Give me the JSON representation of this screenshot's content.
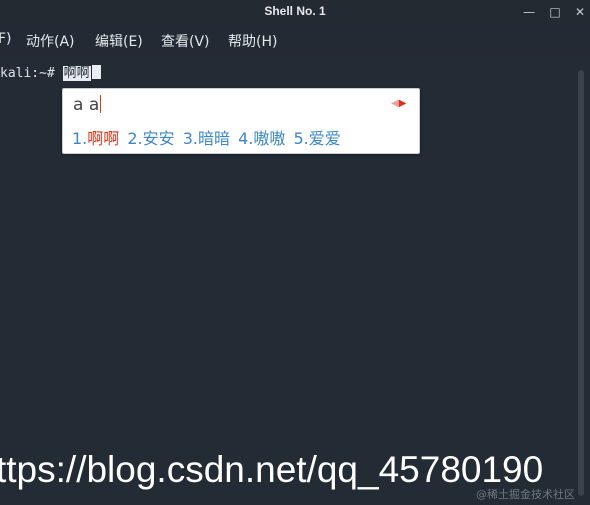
{
  "window": {
    "title": "Shell No. 1",
    "minimize_glyph": "—",
    "maximize_glyph": "□",
    "close_glyph": "✕"
  },
  "menu": {
    "items": [
      "F)",
      "动作(A)",
      "编辑(E)",
      "查看(V)",
      "帮助(H)"
    ]
  },
  "terminal": {
    "prompt": "kali:~# ",
    "typed_text": "啊啊"
  },
  "ime": {
    "code": "a a",
    "prev_glyph": "◀",
    "next_glyph": "▶",
    "candidates": [
      {
        "num": "1.",
        "text": "啊啊",
        "selected": true
      },
      {
        "num": "2.",
        "text": "安安",
        "selected": false
      },
      {
        "num": "3.",
        "text": "暗暗",
        "selected": false
      },
      {
        "num": "4.",
        "text": "嗷嗷",
        "selected": false
      },
      {
        "num": "5.",
        "text": "爱爱",
        "selected": false
      }
    ]
  },
  "watermark": {
    "url_text": "ttps://blog.csdn.net/qq_45780190",
    "juejin_text": "@稀土掘金技术社区"
  }
}
